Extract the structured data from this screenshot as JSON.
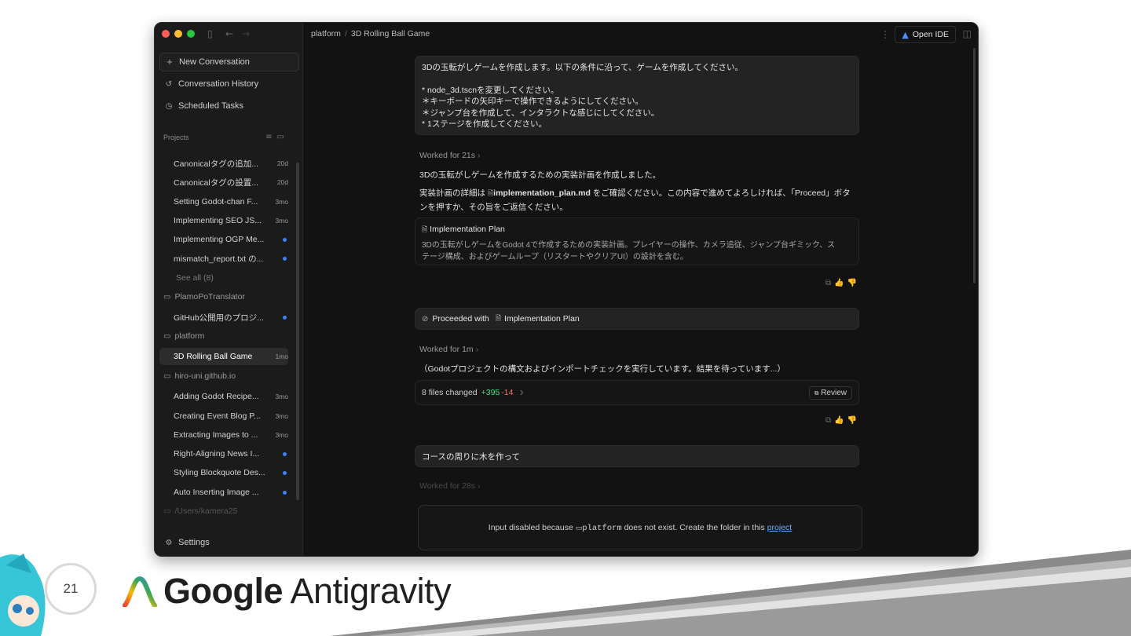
{
  "window": {
    "breadcrumb": {
      "root": "platform",
      "page": "3D Rolling Ball Game"
    },
    "open_ide_label": "Open IDE"
  },
  "sidebar": {
    "new_conversation": "New Conversation",
    "conversation_history": "Conversation History",
    "scheduled_tasks": "Scheduled Tasks",
    "projects_label": "Projects",
    "settings": "Settings",
    "groups": [
      {
        "items": [
          {
            "title": "Canonicalタグの追加...",
            "age": "20d"
          },
          {
            "title": "Canonicalタグの設置...",
            "age": "20d"
          },
          {
            "title": "Setting Godot-chan F...",
            "age": "3mo"
          },
          {
            "title": "Implementing SEO JS...",
            "age": "3mo"
          },
          {
            "title": "Implementing OGP Me...",
            "age": ""
          },
          {
            "title": "mismatch_report.txt の...",
            "age": ""
          }
        ],
        "see_all": "See all (8)"
      },
      {
        "folder": "PlamoPoTranslator",
        "items": [
          {
            "title": "GitHub公開用のプロジ...",
            "age": ""
          }
        ]
      },
      {
        "folder": "platform",
        "items": [
          {
            "title": "3D Rolling Ball Game",
            "age": "1mo"
          }
        ]
      },
      {
        "folder": "hiro-uni.github.io",
        "items": [
          {
            "title": "Adding Godot Recipe...",
            "age": "3mo"
          },
          {
            "title": "Creating Event Blog P...",
            "age": "3mo"
          },
          {
            "title": "Extracting Images to ...",
            "age": "3mo"
          },
          {
            "title": "Right-Aligning News I...",
            "age": ""
          },
          {
            "title": "Styling Blockquote Des...",
            "age": ""
          },
          {
            "title": "Auto Inserting Image ...",
            "age": ""
          }
        ]
      },
      {
        "folder": "/Users/kamera25"
      }
    ]
  },
  "chat": {
    "user_message_1": {
      "line1": "3Dの玉転がしゲームを作成します。以下の条件に沿って、ゲームを作成してください。",
      "line2": "* node_3d.tscnを変更してください。",
      "line3": "＊キーボードの矢印キーで操作できるようにしてください。",
      "line4": "＊ジャンプ台を作成して、インタラクトな感じにしてください。",
      "line5": "* 1ステージを作成してください。"
    },
    "worked_1": "Worked for 21s",
    "reply_1": "3Dの玉転がしゲームを作成するための実装計画を作成しました。",
    "reply_2a": "実装計画の詳細は",
    "reply_2_file": "implementation_plan.md",
    "reply_2b": "をご確認ください。この内容で進めてよろしければ、「Proceed」ボタ",
    "reply_2c": "ンを押すか、その旨をご返信ください。",
    "plan_card": {
      "title": "Implementation Plan",
      "desc1": "3Dの玉転がしゲームをGodot 4で作成するための実装計画。プレイヤーの操作、カメラ追従、ジャンプ台ギミック、ス",
      "desc2": "テージ構成、およびゲームループ（リスタートやクリアUI）の設計を含む。"
    },
    "proceeded": {
      "label": "Proceeded with",
      "target": "Implementation Plan"
    },
    "worked_2": "Worked for 1m",
    "reply_3": "（Godotプロジェクトの構文およびインポートチェックを実行しています。結果を待っています...）",
    "files": {
      "label": "8 files changed",
      "added": "+395",
      "removed": "-14",
      "review": "Review"
    },
    "user_message_2": "コースの周りに木を作って",
    "worked_3": "Worked for 28s",
    "input_notice": {
      "pre": "Input disabled because",
      "folder": "platform",
      "mid": "does not exist. Create the folder in this",
      "link": "project"
    }
  },
  "slide": {
    "page_number": "21",
    "brand_bold": "Google",
    "brand_rest": "Antigravity"
  },
  "colors": {
    "accent": "#3b82f6",
    "added": "#4ade80",
    "removed": "#f87171"
  }
}
